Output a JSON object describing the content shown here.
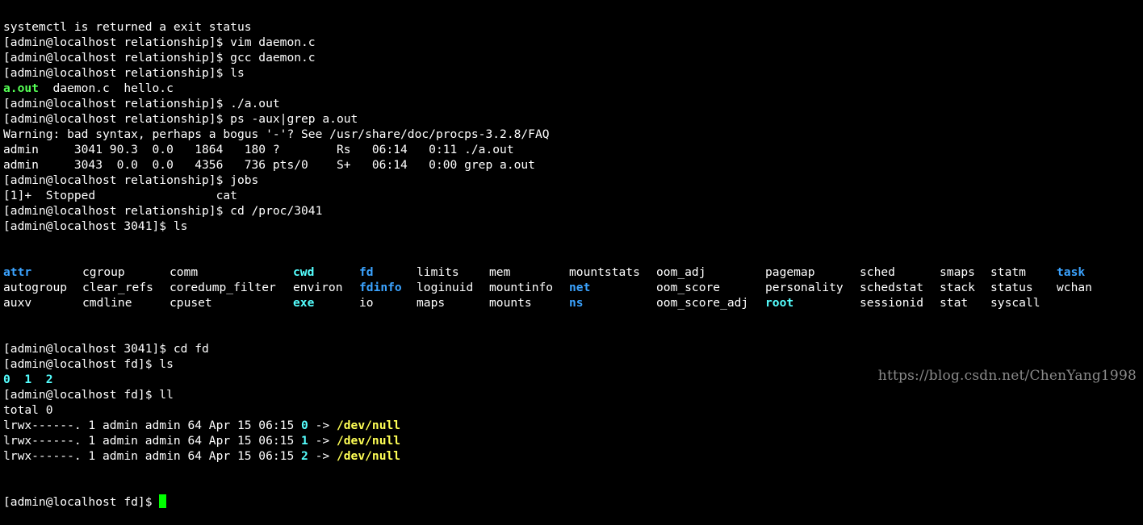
{
  "colors": {
    "background": "#000000",
    "text": "#ffffff",
    "executable": "#55ff55",
    "directory": "#3ba3ff",
    "symlink": "#55ffff",
    "device": "#ffff55",
    "cursor": "#00ff00"
  },
  "terminal": {
    "lines": [
      {
        "segments": [
          {
            "text": "systemctl is returned a exit status",
            "style": ""
          }
        ]
      },
      {
        "segments": [
          {
            "text": "[admin@localhost relationship]$ vim daemon.c",
            "style": ""
          }
        ]
      },
      {
        "segments": [
          {
            "text": "[admin@localhost relationship]$ gcc daemon.c",
            "style": ""
          }
        ]
      },
      {
        "segments": [
          {
            "text": "[admin@localhost relationship]$ ls",
            "style": ""
          }
        ]
      },
      {
        "segments": [
          {
            "text": "a.out",
            "style": "green"
          },
          {
            "text": "  daemon.c  hello.c",
            "style": ""
          }
        ]
      },
      {
        "segments": [
          {
            "text": "[admin@localhost relationship]$ ./a.out",
            "style": ""
          }
        ]
      },
      {
        "segments": [
          {
            "text": "[admin@localhost relationship]$ ps -aux|grep a.out",
            "style": ""
          }
        ]
      },
      {
        "segments": [
          {
            "text": "Warning: bad syntax, perhaps a bogus '-'? See /usr/share/doc/procps-3.2.8/FAQ",
            "style": ""
          }
        ]
      },
      {
        "segments": [
          {
            "text": "admin     3041 90.3  0.0   1864   180 ?        Rs   06:14   0:11 ./a.out",
            "style": ""
          }
        ]
      },
      {
        "segments": [
          {
            "text": "admin     3043  0.0  0.0   4356   736 pts/0    S+   06:14   0:00 grep a.out",
            "style": ""
          }
        ]
      },
      {
        "segments": [
          {
            "text": "[admin@localhost relationship]$ jobs",
            "style": ""
          }
        ]
      },
      {
        "segments": [
          {
            "text": "[1]+  Stopped                 cat",
            "style": ""
          }
        ]
      },
      {
        "segments": [
          {
            "text": "[admin@localhost relationship]$ cd /proc/3041",
            "style": ""
          }
        ]
      },
      {
        "segments": [
          {
            "text": "[admin@localhost 3041]$ ls",
            "style": ""
          }
        ]
      }
    ],
    "ls_grid": [
      [
        {
          "text": "attr",
          "style": "blue"
        },
        {
          "text": "cgroup",
          "style": ""
        },
        {
          "text": "comm",
          "style": ""
        },
        {
          "text": "cwd",
          "style": "cyan"
        },
        {
          "text": "fd",
          "style": "blue"
        },
        {
          "text": "limits",
          "style": ""
        },
        {
          "text": "mem",
          "style": ""
        },
        {
          "text": "mountstats",
          "style": ""
        },
        {
          "text": "oom_adj",
          "style": ""
        },
        {
          "text": "pagemap",
          "style": ""
        },
        {
          "text": "sched",
          "style": ""
        },
        {
          "text": "smaps",
          "style": ""
        },
        {
          "text": "statm",
          "style": ""
        },
        {
          "text": "task",
          "style": "blue"
        }
      ],
      [
        {
          "text": "autogroup",
          "style": ""
        },
        {
          "text": "clear_refs",
          "style": ""
        },
        {
          "text": "coredump_filter",
          "style": ""
        },
        {
          "text": "environ",
          "style": ""
        },
        {
          "text": "fdinfo",
          "style": "blue"
        },
        {
          "text": "loginuid",
          "style": ""
        },
        {
          "text": "mountinfo",
          "style": ""
        },
        {
          "text": "net",
          "style": "blue"
        },
        {
          "text": "oom_score",
          "style": ""
        },
        {
          "text": "personality",
          "style": ""
        },
        {
          "text": "schedstat",
          "style": ""
        },
        {
          "text": "stack",
          "style": ""
        },
        {
          "text": "status",
          "style": ""
        },
        {
          "text": "wchan",
          "style": ""
        }
      ],
      [
        {
          "text": "auxv",
          "style": ""
        },
        {
          "text": "cmdline",
          "style": ""
        },
        {
          "text": "cpuset",
          "style": ""
        },
        {
          "text": "exe",
          "style": "cyan"
        },
        {
          "text": "io",
          "style": ""
        },
        {
          "text": "maps",
          "style": ""
        },
        {
          "text": "mounts",
          "style": ""
        },
        {
          "text": "ns",
          "style": "blue"
        },
        {
          "text": "oom_score_adj",
          "style": ""
        },
        {
          "text": "root",
          "style": "cyan"
        },
        {
          "text": "sessionid",
          "style": ""
        },
        {
          "text": "stat",
          "style": ""
        },
        {
          "text": "syscall",
          "style": ""
        },
        {
          "text": "",
          "style": ""
        }
      ]
    ],
    "lines_after": [
      {
        "segments": [
          {
            "text": "[admin@localhost 3041]$ cd fd",
            "style": ""
          }
        ]
      },
      {
        "segments": [
          {
            "text": "[admin@localhost fd]$ ls",
            "style": ""
          }
        ]
      },
      {
        "segments": [
          {
            "text": "0",
            "style": "cyan"
          },
          {
            "text": "  ",
            "style": ""
          },
          {
            "text": "1",
            "style": "cyan"
          },
          {
            "text": "  ",
            "style": ""
          },
          {
            "text": "2",
            "style": "cyan"
          }
        ]
      },
      {
        "segments": [
          {
            "text": "[admin@localhost fd]$ ll",
            "style": ""
          }
        ]
      },
      {
        "segments": [
          {
            "text": "total 0",
            "style": ""
          }
        ]
      },
      {
        "segments": [
          {
            "text": "lrwx------. 1 admin admin 64 Apr 15 06:15 ",
            "style": ""
          },
          {
            "text": "0",
            "style": "cyan"
          },
          {
            "text": " -> ",
            "style": ""
          },
          {
            "text": "/dev/null",
            "style": "yellow"
          }
        ]
      },
      {
        "segments": [
          {
            "text": "lrwx------. 1 admin admin 64 Apr 15 06:15 ",
            "style": ""
          },
          {
            "text": "1",
            "style": "cyan"
          },
          {
            "text": " -> ",
            "style": ""
          },
          {
            "text": "/dev/null",
            "style": "yellow"
          }
        ]
      },
      {
        "segments": [
          {
            "text": "lrwx------. 1 admin admin 64 Apr 15 06:15 ",
            "style": ""
          },
          {
            "text": "2",
            "style": "cyan"
          },
          {
            "text": " -> ",
            "style": ""
          },
          {
            "text": "/dev/null",
            "style": "yellow"
          }
        ]
      }
    ],
    "prompt": "[admin@localhost fd]$ "
  },
  "watermark": "https://blog.csdn.net/ChenYang1998"
}
